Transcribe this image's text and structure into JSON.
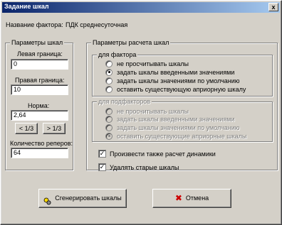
{
  "window": {
    "title": "Задание шкал",
    "close_glyph": "x"
  },
  "factor": {
    "label": "Название фактора:",
    "name": "ПДК среднесуточная"
  },
  "scale_params": {
    "legend": "Параметры  шкал",
    "left_bound_label": "Левая граница:",
    "left_bound_value": "0",
    "right_bound_label": "Правая граница:",
    "right_bound_value": "10",
    "norm_label": "Норма:",
    "norm_value": "2,64",
    "minus_third_label": "< 1/3",
    "plus_third_label": "> 1/3",
    "markers_label": "Количество реперов:",
    "markers_value": "64"
  },
  "calc_params": {
    "legend": "Параметры расчета шкал",
    "factor_group": {
      "legend": "для фактора",
      "options": [
        {
          "label": "не просчитывать шкалы",
          "checked": false
        },
        {
          "label": "задать шкалы введенными значениями",
          "checked": true
        },
        {
          "label": "задать шкалы значениями по умолчанию",
          "checked": false
        },
        {
          "label": "оставить существующую априорную шкалу",
          "checked": false
        }
      ]
    },
    "subfactor_group": {
      "legend": "для подфакторов",
      "options": [
        {
          "label": "не просчитывать шкалы",
          "checked": false
        },
        {
          "label": "задать шкалы введенными значениями",
          "checked": false
        },
        {
          "label": "задать шкалы значениями по умолчанию",
          "checked": false
        },
        {
          "label": "оставить существующие априорные шкалы",
          "checked": true
        }
      ]
    },
    "dynamics_label": "Произвести также расчет динамики",
    "dynamics_checked": true,
    "delete_old_label": "Удалять старые шкалы",
    "delete_old_checked": true
  },
  "buttons": {
    "generate_label": "Сгенерировать шкалы",
    "cancel_label": "Отмена"
  },
  "colors": {
    "title_start": "#0a246a",
    "title_end": "#a6caf0",
    "face": "#d4d0c8",
    "cancel_icon": "#cc0000"
  }
}
